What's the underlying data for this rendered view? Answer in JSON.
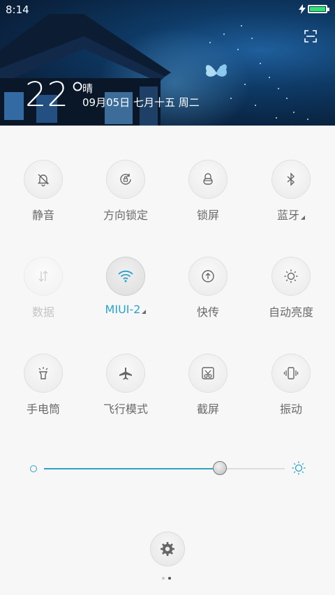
{
  "status": {
    "time": "8:14",
    "battery_color": "#2fe66a"
  },
  "weather": {
    "temperature": "22°",
    "condition": "晴",
    "date": "09月05日 七月十五 周二"
  },
  "toggles": [
    {
      "label": "静音",
      "icon": "bell-off-icon",
      "state": "off"
    },
    {
      "label": "方向锁定",
      "icon": "rotation-lock-icon",
      "state": "off"
    },
    {
      "label": "锁屏",
      "icon": "lock-icon",
      "state": "off"
    },
    {
      "label": "蓝牙",
      "icon": "bluetooth-icon",
      "state": "off"
    },
    {
      "label": "数据",
      "icon": "data-arrows-icon",
      "state": "disabled"
    },
    {
      "label": "MIUI-2",
      "icon": "wifi-icon",
      "state": "on"
    },
    {
      "label": "快传",
      "icon": "upload-icon",
      "state": "off"
    },
    {
      "label": "自动亮度",
      "icon": "sun-icon",
      "state": "off"
    },
    {
      "label": "手电筒",
      "icon": "flashlight-icon",
      "state": "off"
    },
    {
      "label": "飞行模式",
      "icon": "airplane-icon",
      "state": "off"
    },
    {
      "label": "截屏",
      "icon": "screenshot-icon",
      "state": "off"
    },
    {
      "label": "振动",
      "icon": "vibrate-icon",
      "state": "off"
    }
  ],
  "brightness": {
    "level": 0.73,
    "accent": "#2aa3c9"
  },
  "pager": {
    "pages": 2,
    "current": 2
  }
}
